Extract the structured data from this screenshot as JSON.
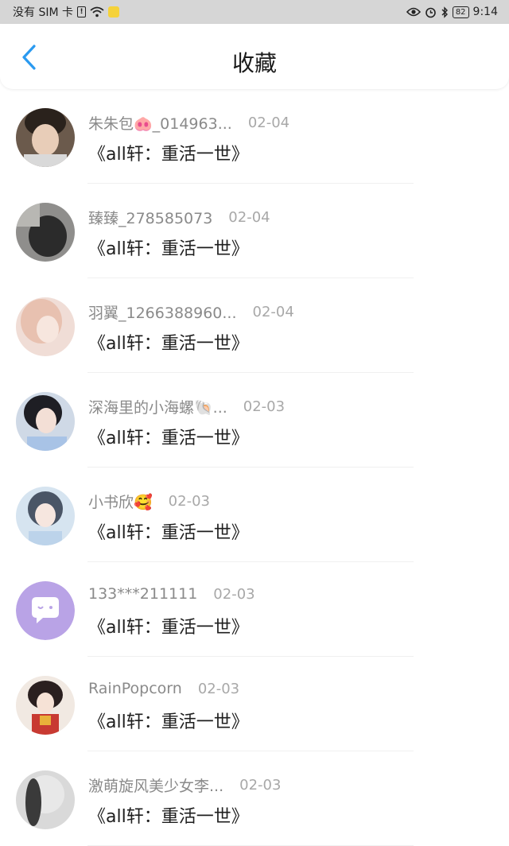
{
  "status_bar": {
    "carrier": "没有 SIM 卡",
    "battery": "82",
    "time": "9:14"
  },
  "header": {
    "title": "收藏",
    "back_icon": "chevron-left-icon"
  },
  "colors": {
    "accent": "#2a9af0",
    "status_bar_bg": "#d6d6d6",
    "meta_text": "#8a8a8a",
    "title_text": "#1e1e1e",
    "default_avatar_bg": "#b9a3e6"
  },
  "items": [
    {
      "name": "朱朱包🐽_014963...",
      "date": "02-04",
      "title": "《all轩：重活一世》"
    },
    {
      "name": "臻臻_278585073",
      "date": "02-04",
      "title": "《all轩：重活一世》"
    },
    {
      "name": "羽翼_1266388960...",
      "date": "02-04",
      "title": "《all轩：重活一世》"
    },
    {
      "name": "深海里的小海螺🐚...",
      "date": "02-03",
      "title": "《all轩：重活一世》"
    },
    {
      "name": "小书欣🥰",
      "date": "02-03",
      "title": "《all轩：重活一世》"
    },
    {
      "name": "133***211111",
      "date": "02-03",
      "title": "《all轩：重活一世》"
    },
    {
      "name": "RainPopcorn",
      "date": "02-03",
      "title": "《all轩：重活一世》"
    },
    {
      "name": "激萌旋风美少女李...",
      "date": "02-03",
      "title": "《all轩：重活一世》"
    }
  ]
}
